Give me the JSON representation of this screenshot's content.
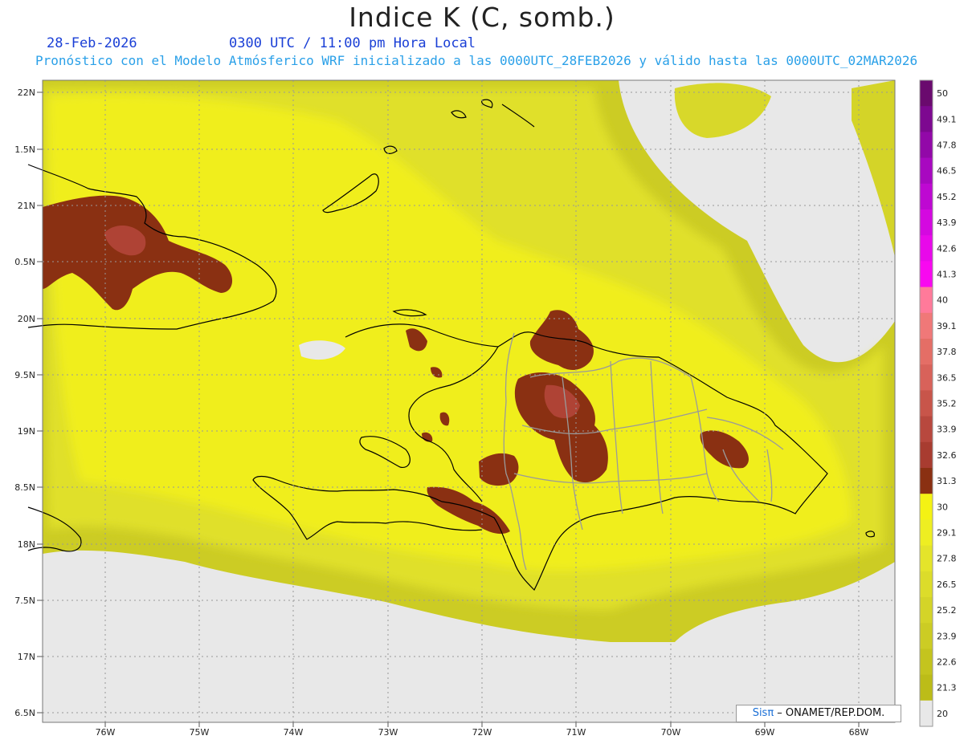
{
  "header": {
    "title": "Indice K (C, somb.)",
    "date": "28-Feb-2026",
    "time": "0300 UTC / 11:00 pm Hora Local",
    "subtitle": "Pronóstico con el Modelo Atmósferico WRF inicializado a las 0000UTC_28FEB2026 y válido hasta las  0000UTC_02MAR2026"
  },
  "axes": {
    "lat_labels": [
      "22N",
      "1.5N",
      "21N",
      "0.5N",
      "20N",
      "9.5N",
      "19N",
      "8.5N",
      "18N",
      "7.5N",
      "17N",
      "6.5N"
    ],
    "lon_labels": [
      "76W",
      "75W",
      "74W",
      "73W",
      "72W",
      "71W",
      "70W",
      "69W",
      "68W"
    ]
  },
  "colorbar": {
    "labels": [
      "50",
      "49.1",
      "47.8",
      "46.5",
      "45.2",
      "43.9",
      "42.6",
      "41.3",
      "40",
      "39.1",
      "37.8",
      "36.5",
      "35.2",
      "33.9",
      "32.6",
      "31.3",
      "30",
      "29.1",
      "27.8",
      "26.5",
      "25.2",
      "23.9",
      "22.6",
      "21.3",
      "20"
    ],
    "colors": [
      "#6a0a6e",
      "#7d0890",
      "#9208a8",
      "#a808c0",
      "#be08d2",
      "#d408e0",
      "#e808ea",
      "#f808f0",
      "#ff7a9a",
      "#f07878",
      "#e46e66",
      "#d8625a",
      "#c8554a",
      "#b8483e",
      "#a83c30",
      "#8a3012",
      "#f4f214",
      "#eeee22",
      "#e4e42a",
      "#dcdc2a",
      "#d4d428",
      "#cccc24",
      "#c4c41e",
      "#bcbc18"
    ]
  },
  "credit": {
    "brand": "Sisπ",
    "text": " – ONAMET/REP.DOM."
  }
}
